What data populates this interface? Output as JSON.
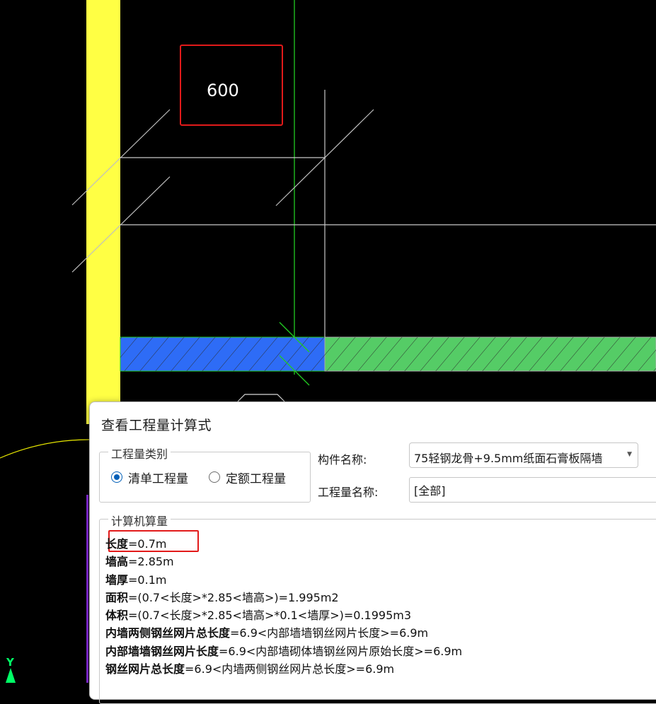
{
  "canvas": {
    "dimension_value": "600",
    "axis_label": "Y",
    "colors": {
      "background": "#000000",
      "wall_yellow": "#ffff44",
      "selected_wall": "#2e6cf6",
      "wall_green": "#55cc66",
      "axis_line": "#22cc22",
      "highlight_box": "#e21a1a",
      "grid_line": "#c8c8c8"
    }
  },
  "dialog": {
    "title": "查看工程量计算式",
    "quantity_type": {
      "legend": "工程量类别",
      "options": [
        {
          "label": "清单工程量",
          "checked": true
        },
        {
          "label": "定额工程量",
          "checked": false
        }
      ]
    },
    "component": {
      "label": "构件名称:",
      "value": "75轻钢龙骨+9.5mm纸面石膏板隔墙"
    },
    "quantity_name": {
      "label": "工程量名称:",
      "value": "[全部]"
    },
    "calc": {
      "legend": "计算机算量",
      "lines": [
        {
          "name": "长度",
          "expr": "=0.7m"
        },
        {
          "name": "墙高",
          "expr": "=2.85m"
        },
        {
          "name": "墙厚",
          "expr": "=0.1m"
        },
        {
          "name": "面积",
          "expr": "=(0.7<长度>*2.85<墙高>)=1.995m2"
        },
        {
          "name": "体积",
          "expr": "=(0.7<长度>*2.85<墙高>*0.1<墙厚>)=0.1995m3"
        },
        {
          "name": "内墙两侧钢丝网片总长度",
          "expr": "=6.9<内部墙墙钢丝网片长度>=6.9m"
        },
        {
          "name": "内部墙墙钢丝网片长度",
          "expr": "=6.9<内部墙砌体墙钢丝网片原始长度>=6.9m"
        },
        {
          "name": "钢丝网片总长度",
          "expr": "=6.9<内墙两侧钢丝网片总长度>=6.9m"
        }
      ]
    }
  }
}
